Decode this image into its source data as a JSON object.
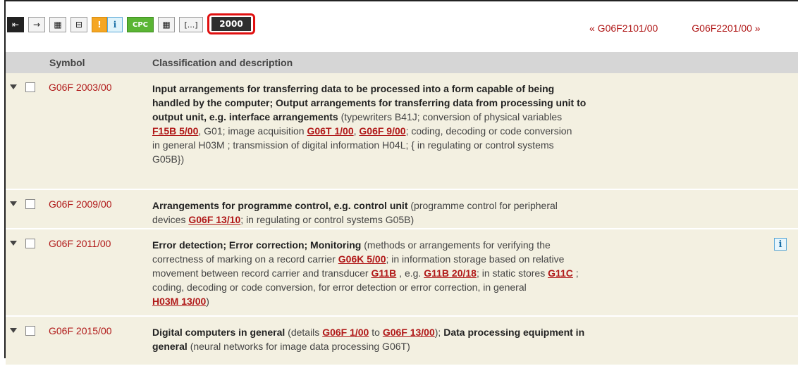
{
  "toolbar": {
    "buttons": [
      {
        "name": "back-button",
        "glyph": "⇤"
      },
      {
        "name": "forward-button",
        "glyph": "→"
      },
      {
        "name": "tree-view-button",
        "glyph": "▦"
      },
      {
        "name": "compact-view-button",
        "glyph": "⊟"
      },
      {
        "name": "warning-button",
        "glyph": "!"
      },
      {
        "name": "info-button",
        "glyph": "i"
      },
      {
        "name": "cpc-button",
        "glyph": "CPC"
      },
      {
        "name": "grid-button",
        "glyph": "▦"
      },
      {
        "name": "expand-button",
        "glyph": "[...]"
      },
      {
        "name": "year-2000-button",
        "glyph": "2000"
      }
    ]
  },
  "nav": {
    "prev": "« G06F2101/00",
    "next": "G06F2201/00 »"
  },
  "table": {
    "col_symbol": "Symbol",
    "col_desc": "Classification and description"
  },
  "rows": [
    {
      "symbol": "G06F 2003/00",
      "lines": [
        [
          {
            "b": "Input arrangements for transferring data to be processed into a form capable of being"
          }
        ],
        [
          {
            "b": "handled by the computer; Output arrangements for transferring data from processing unit to"
          }
        ],
        [
          {
            "b": "output unit, e.g. interface arrangements"
          },
          {
            "t": " (typewriters B41J; conversion of physical variables"
          }
        ],
        [
          {
            "u": "F15B 5/00"
          },
          {
            "t": ", G01; image acquisition "
          },
          {
            "u": "G06T 1/00"
          },
          {
            "t": ", "
          },
          {
            "u": "G06F 9/00"
          },
          {
            "t": "; coding, decoding or code conversion"
          }
        ],
        [
          {
            "t": "in general H03M ; transmission of digital information H04L; { in regulating or control systems"
          }
        ],
        [
          {
            "t": "G05B})"
          }
        ]
      ]
    },
    {
      "symbol": "G06F 2009/00",
      "lines": [
        [
          {
            "b": "Arrangements for programme control, e.g. control unit"
          },
          {
            "t": " (programme control for peripheral"
          }
        ],
        [
          {
            "t": "devices "
          },
          {
            "u": "G06F 13/10"
          },
          {
            "t": "; in regulating or control systems G05B)"
          }
        ]
      ]
    },
    {
      "symbol": "G06F 2011/00",
      "info": "i",
      "lines": [
        [
          {
            "b": "Error detection; Error correction; Monitoring"
          },
          {
            "t": " (methods or arrangements for verifying the"
          }
        ],
        [
          {
            "t": "correctness of marking on a record carrier "
          },
          {
            "u": "G06K 5/00"
          },
          {
            "t": "; in information storage based on relative"
          }
        ],
        [
          {
            "t": "movement between record carrier and transducer "
          },
          {
            "u": "G11B"
          },
          {
            "t": " , e.g. "
          },
          {
            "u": "G11B 20/18"
          },
          {
            "t": "; in static stores "
          },
          {
            "u": "G11C"
          },
          {
            "t": " ;"
          }
        ],
        [
          {
            "t": "coding, decoding or code conversion, for error detection or error correction, in general"
          }
        ],
        [
          {
            "u": "H03M 13/00"
          },
          {
            "t": ")"
          }
        ]
      ]
    },
    {
      "symbol": "G06F 2015/00",
      "lines": [
        [
          {
            "b": "Digital computers in general"
          },
          {
            "t": " (details "
          },
          {
            "u": "G06F 1/00"
          },
          {
            "t": " to "
          },
          {
            "u": "G06F 13/00"
          },
          {
            "t": "); "
          },
          {
            "b": "Data processing equipment in"
          }
        ],
        [
          {
            "b": "general"
          },
          {
            "t": " (neural networks for image data processing G06T)"
          }
        ]
      ]
    }
  ]
}
